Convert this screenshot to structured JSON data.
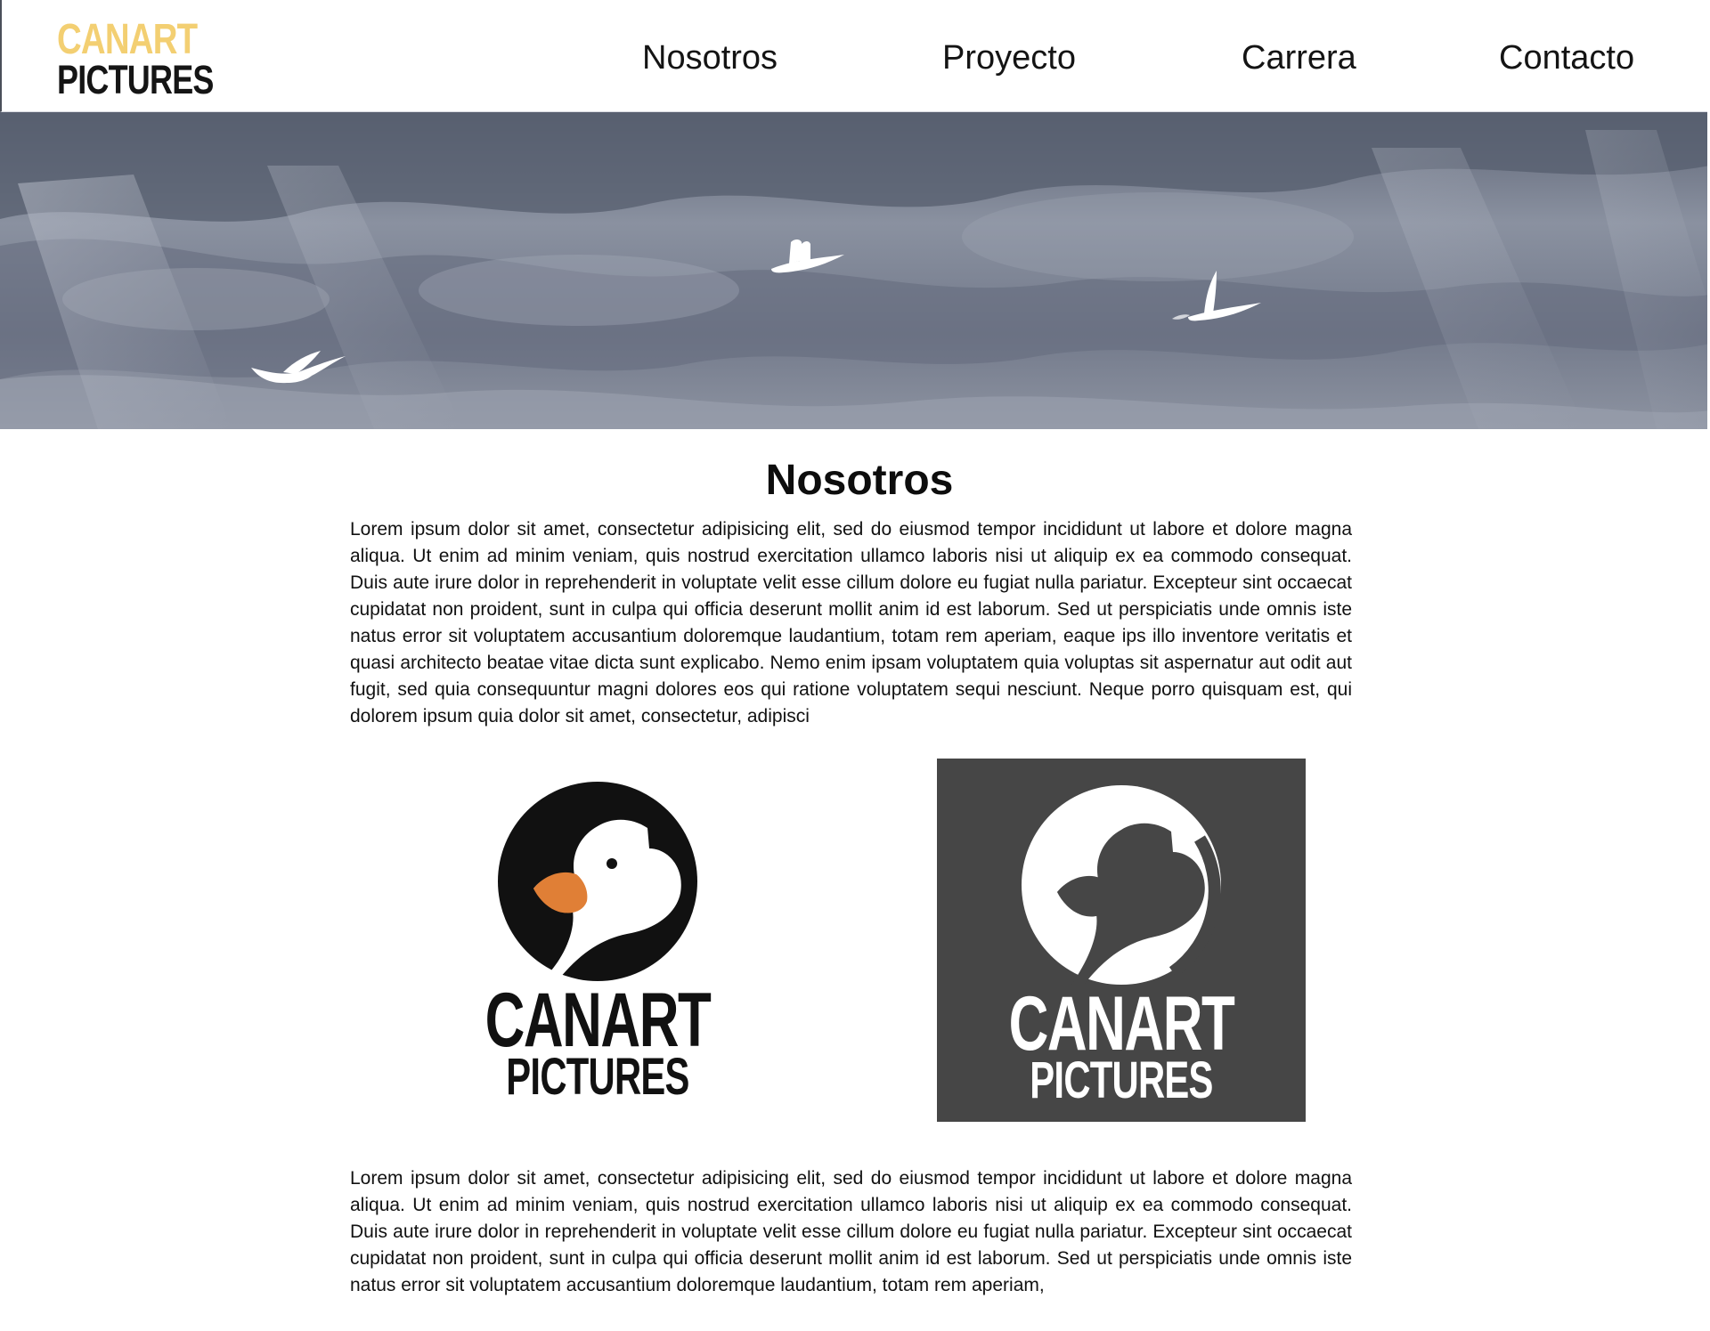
{
  "header": {
    "logo": {
      "line1": "CANART",
      "line2": "PICTURES"
    },
    "nav": [
      "Nosotros",
      "Proyecto",
      "Carrera",
      "Contacto"
    ]
  },
  "hero": {
    "image": "stormy-sky-with-birds"
  },
  "about": {
    "title": "Nosotros",
    "paragraph1": "Lorem ipsum dolor sit amet, consectetur adipisicing elit, sed do eiusmod tempor incididunt ut labore et dolore magna aliqua. Ut enim ad minim veniam, quis nostrud exercitation ullamco laboris nisi ut aliquip ex ea commodo consequat. Duis aute irure dolor in reprehenderit in voluptate velit esse cillum dolore eu fugiat nulla pariatur. Excepteur sint occaecat cupidatat non proident, sunt in culpa qui officia deserunt mollit anim id est laborum. Sed ut perspiciatis unde omnis iste natus error sit voluptatem accusantium doloremque laudantium, totam rem aperiam, eaque ips illo inventore veritatis et quasi architecto beatae vitae dicta sunt explicabo. Nemo enim ipsam voluptatem quia voluptas sit aspernatur aut odit aut fugit, sed quia consequuntur magni dolores eos qui ratione voluptatem sequi nesciunt. Neque porro quisquam est, qui dolorem ipsum quia dolor sit amet, consectetur, adipisci",
    "logos": [
      {
        "line1": "CANART",
        "line2": "PICTURES",
        "variant": "light",
        "accent": "#e07f36"
      },
      {
        "line1": "CANART",
        "line2": "PICTURES",
        "variant": "dark"
      }
    ],
    "paragraph2": "Lorem ipsum dolor sit amet, consectetur adipisicing elit, sed do eiusmod tempor incididunt ut labore et dolore magna aliqua. Ut enim ad minim veniam, quis nostrud exercitation ullamco laboris nisi ut aliquip ex ea commodo consequat. Duis aute irure dolor in reprehenderit in voluptate velit esse cillum dolore eu fugiat nulla pariatur. Excepteur sint occaecat cupidatat non proident, sunt in culpa qui officia deserunt mollit anim id est laborum. Sed ut perspiciatis unde omnis iste natus error sit voluptatem accusantium doloremque laudantium, totam rem aperiam,"
  },
  "colors": {
    "logo_yellow": "#f3cf72",
    "logo_dark": "#151515",
    "duck_bill": "#e07f36",
    "dark_card": "#464646",
    "sky": "#7d8494"
  }
}
